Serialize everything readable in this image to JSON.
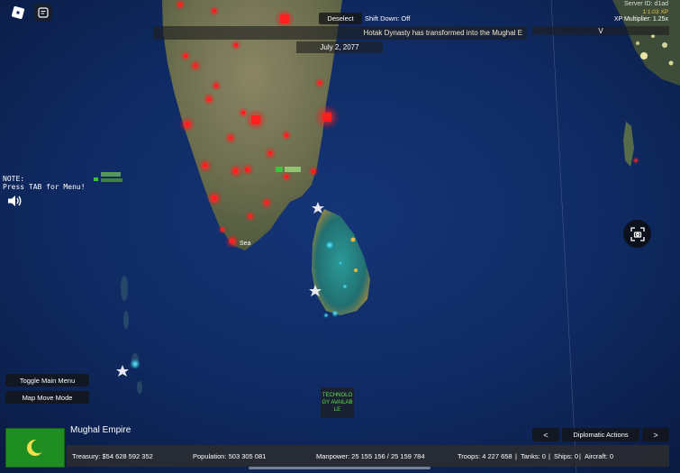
{
  "colors": {
    "ocean": "#0d1f4a",
    "land": "#6e7150",
    "city_glow": "#ff2a2a",
    "flag_green": "#1e8d22",
    "crescent": "#f1e04a",
    "tech_text": "#5fe34d",
    "notice_text": "#f2e9c8"
  },
  "icons": {
    "roblox": "roblox-logo-icon",
    "chat": "chat-icon",
    "sound": "speaker-icon",
    "screenshot": "camera-capture-icon",
    "crescent": "crescent-moon-icon",
    "star": "capital-star-icon"
  },
  "top_bar": {
    "deselect_label": "Deselect",
    "shift_down_text": "Shift Down: Off",
    "notification": "Hotak Dynasty has transformed into the Mughal E",
    "date": "July 2, 2077",
    "v_label": "V"
  },
  "server_info": {
    "server_line": "Server ID: d1ad",
    "server_sub": "1:1:03 XP",
    "xp_multiplier": "XP Multiplier: 1.25x"
  },
  "note": {
    "text": "NOTE:\nPress TAB for Menu!"
  },
  "map_labels": {
    "sea": "Sea"
  },
  "left_buttons": {
    "toggle_main_menu": "Toggle Main Menu",
    "map_move_mode": "Map Move Mode"
  },
  "technology_notice": "TECHNOLOGY AVAILABLE",
  "country": {
    "name": "Mughal Empire"
  },
  "navigation": {
    "prev": "<",
    "diplomatic_actions": "Diplomatic Actions",
    "next": ">"
  },
  "stats": {
    "treasury": "Treasury:  $54 628 592 352",
    "population": "Population: 503 305 081",
    "manpower": "Manpower:  25 155 156  /  25 159 784",
    "troops": "Troops: 4 227 658",
    "tanks": "Tanks: 0",
    "ships": "Ships: 0",
    "aircraft": "Aircraft: 0"
  }
}
